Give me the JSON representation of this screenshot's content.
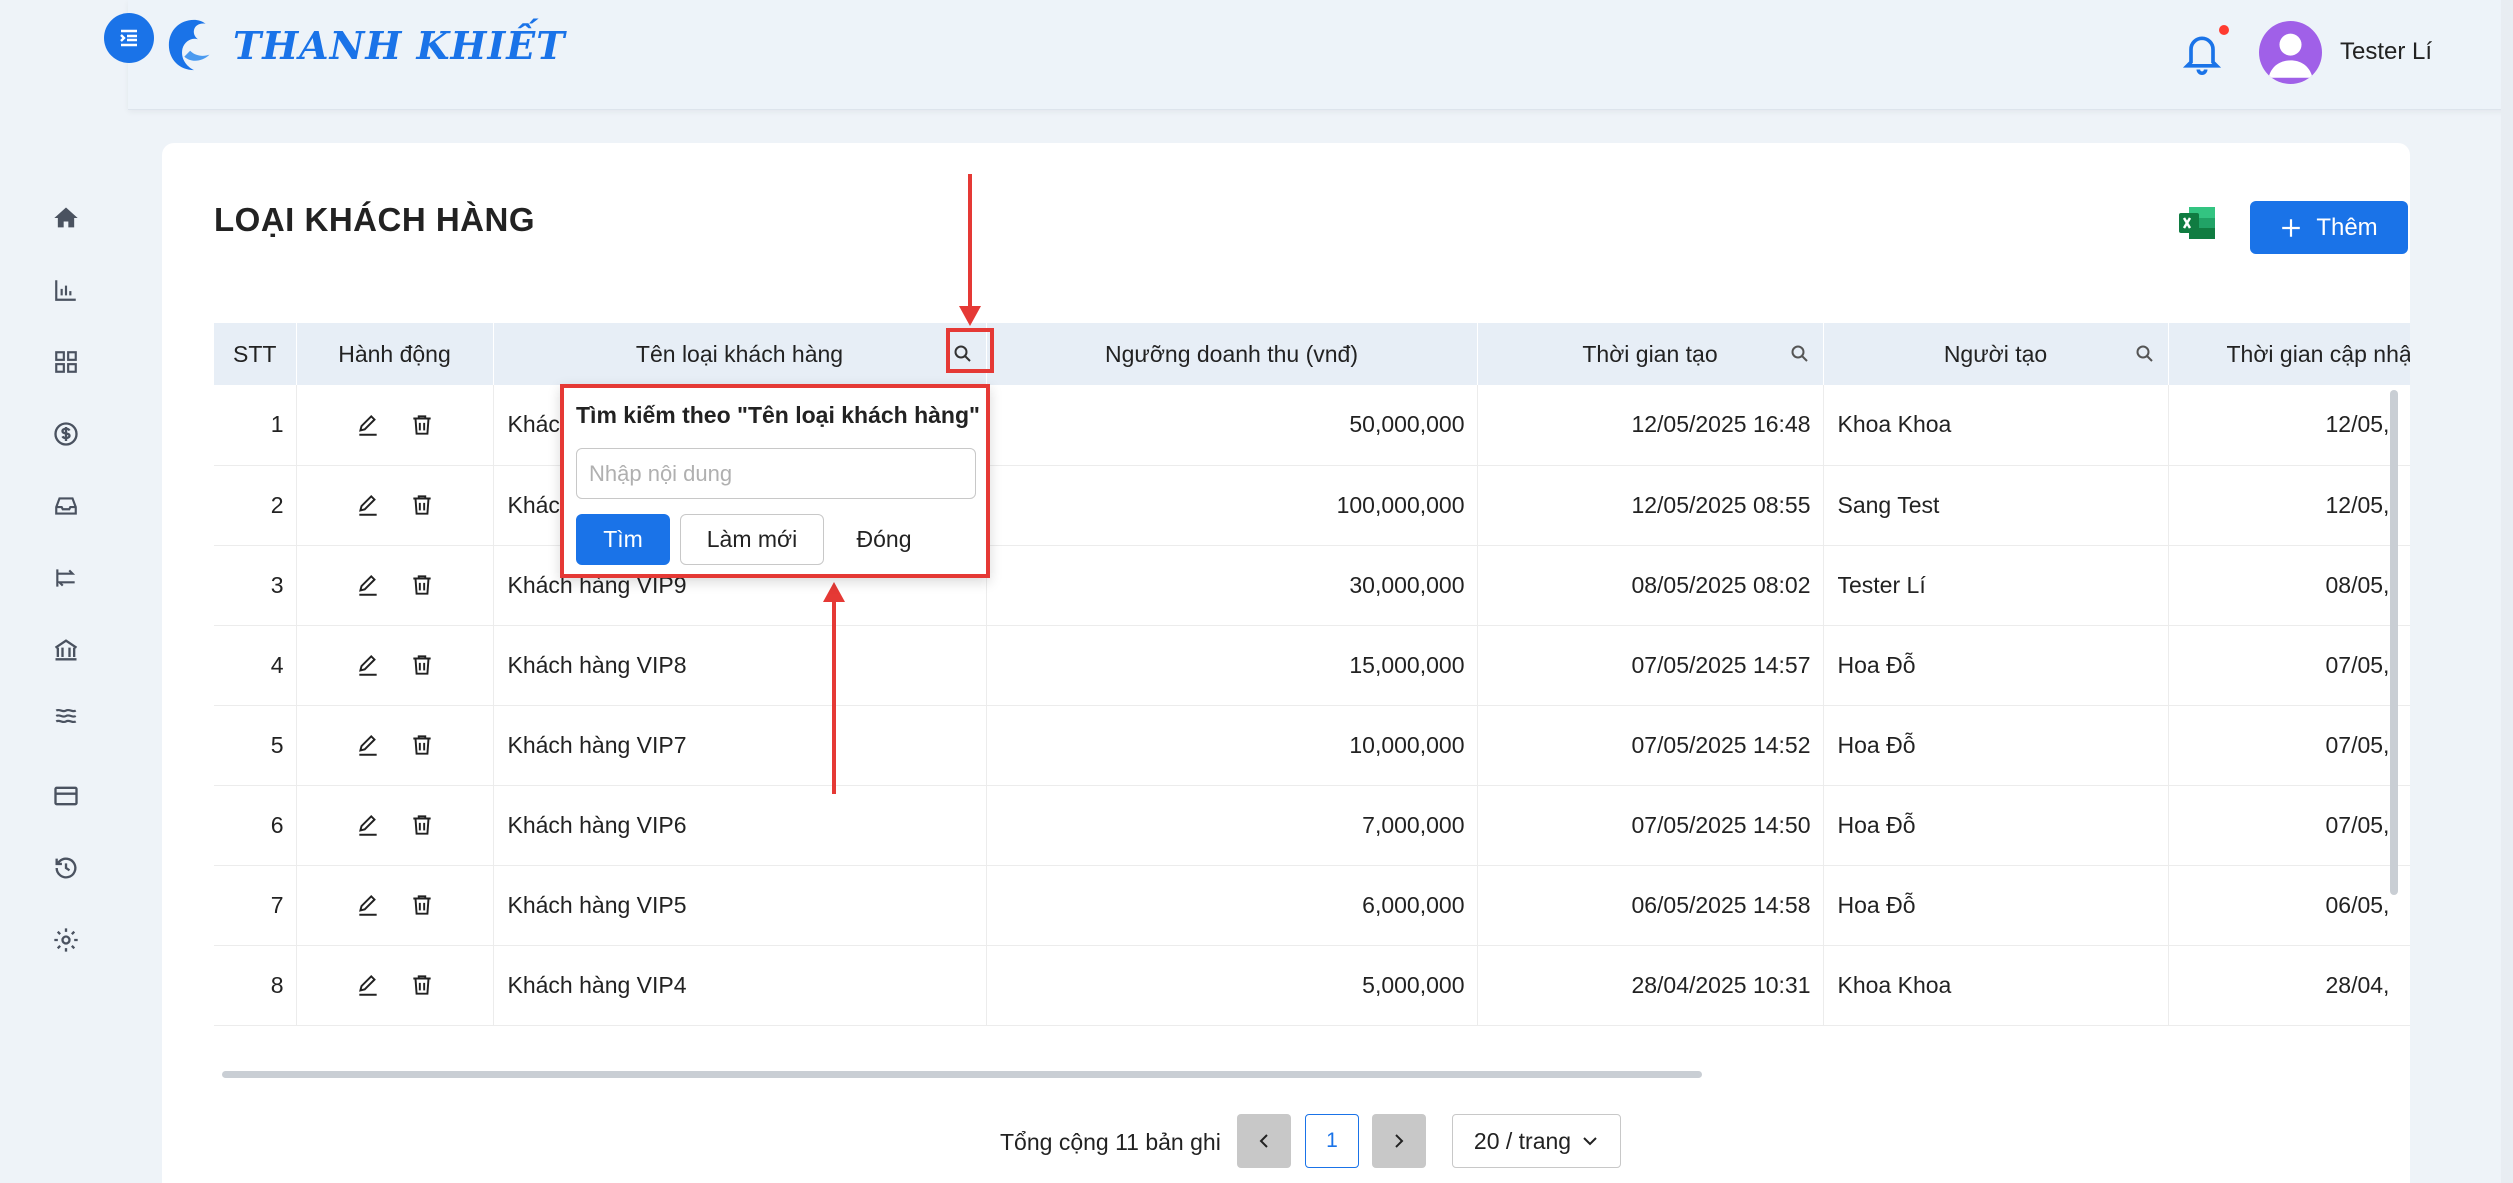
{
  "header": {
    "brand": "THANH KHIẾT",
    "user_name": "Tester Lí"
  },
  "page": {
    "title": "LOẠI KHÁCH HÀNG",
    "add_label": "Thêm"
  },
  "table": {
    "columns": [
      "STT",
      "Hành động",
      "Tên loại khách hàng",
      "Ngưỡng doanh thu (vnđ)",
      "Thời gian tạo",
      "Người tạo",
      "Thời gian cập nhậ"
    ],
    "rows": [
      {
        "stt": "1",
        "name": "Khách",
        "revenue": "50,000,000",
        "created": "12/05/2025 16:48",
        "creator": "Khoa Khoa",
        "updated": "12/05,"
      },
      {
        "stt": "2",
        "name": "Khách",
        "revenue": "100,000,000",
        "created": "12/05/2025 08:55",
        "creator": "Sang Test",
        "updated": "12/05,"
      },
      {
        "stt": "3",
        "name": "Khách hàng VIP9",
        "revenue": "30,000,000",
        "created": "08/05/2025 08:02",
        "creator": "Tester Lí",
        "updated": "08/05,"
      },
      {
        "stt": "4",
        "name": "Khách hàng VIP8",
        "revenue": "15,000,000",
        "created": "07/05/2025 14:57",
        "creator": "Hoa Đỗ",
        "updated": "07/05,"
      },
      {
        "stt": "5",
        "name": "Khách hàng VIP7",
        "revenue": "10,000,000",
        "created": "07/05/2025 14:52",
        "creator": "Hoa Đỗ",
        "updated": "07/05,"
      },
      {
        "stt": "6",
        "name": "Khách hàng VIP6",
        "revenue": "7,000,000",
        "created": "07/05/2025 14:50",
        "creator": "Hoa Đỗ",
        "updated": "07/05,"
      },
      {
        "stt": "7",
        "name": "Khách hàng VIP5",
        "revenue": "6,000,000",
        "created": "06/05/2025 14:58",
        "creator": "Hoa Đỗ",
        "updated": "06/05,"
      },
      {
        "stt": "8",
        "name": "Khách hàng VIP4",
        "revenue": "5,000,000",
        "created": "28/04/2025 10:31",
        "creator": "Khoa Khoa",
        "updated": "28/04,"
      }
    ]
  },
  "search_popup": {
    "title": "Tìm kiếm theo \"Tên loại khách hàng\"",
    "placeholder": "Nhập nội dung",
    "find_label": "Tìm",
    "reset_label": "Làm mới",
    "close_label": "Đóng"
  },
  "pagination": {
    "total_label": "Tổng cộng 11 bản ghi",
    "current_page": "1",
    "page_size_label": "20 / trang"
  },
  "colors": {
    "primary": "#1a73e8",
    "annotation": "#e53935",
    "header_bg": "#e7eef6"
  }
}
